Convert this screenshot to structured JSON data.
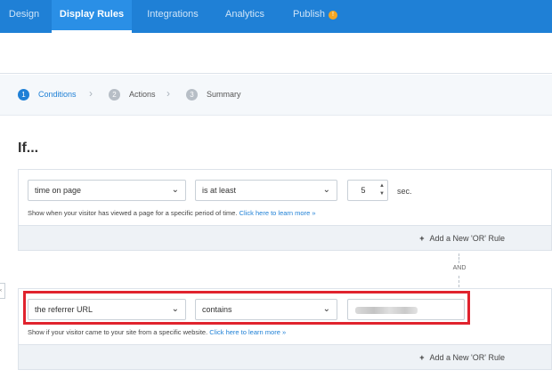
{
  "nav": {
    "tabs": [
      {
        "label": "Design"
      },
      {
        "label": "Display Rules"
      },
      {
        "label": "Integrations"
      },
      {
        "label": "Analytics"
      },
      {
        "label": "Publish"
      }
    ],
    "publish_badge": "!"
  },
  "steps": [
    {
      "num": "1",
      "label": "Conditions"
    },
    {
      "num": "2",
      "label": "Actions"
    },
    {
      "num": "3",
      "label": "Summary"
    }
  ],
  "if_title": "If...",
  "rule1": {
    "condition": "time on page",
    "operator": "is at least",
    "value": "5",
    "unit": "sec.",
    "help": "Show when your visitor has viewed a page for a specific period of time.",
    "help_link": "Click here to learn more »",
    "add_or": "Add a New 'OR' Rule"
  },
  "and_label": "AND",
  "rule2": {
    "condition": "the referrer URL",
    "operator": "contains",
    "help": "Show if your visitor came to your site from a specific website.",
    "help_link": "Click here to learn more »",
    "add_or": "Add a New 'OR' Rule"
  },
  "colors": {
    "brand": "#1f80d6",
    "highlight": "#e0232e",
    "badge": "#f5a623"
  }
}
